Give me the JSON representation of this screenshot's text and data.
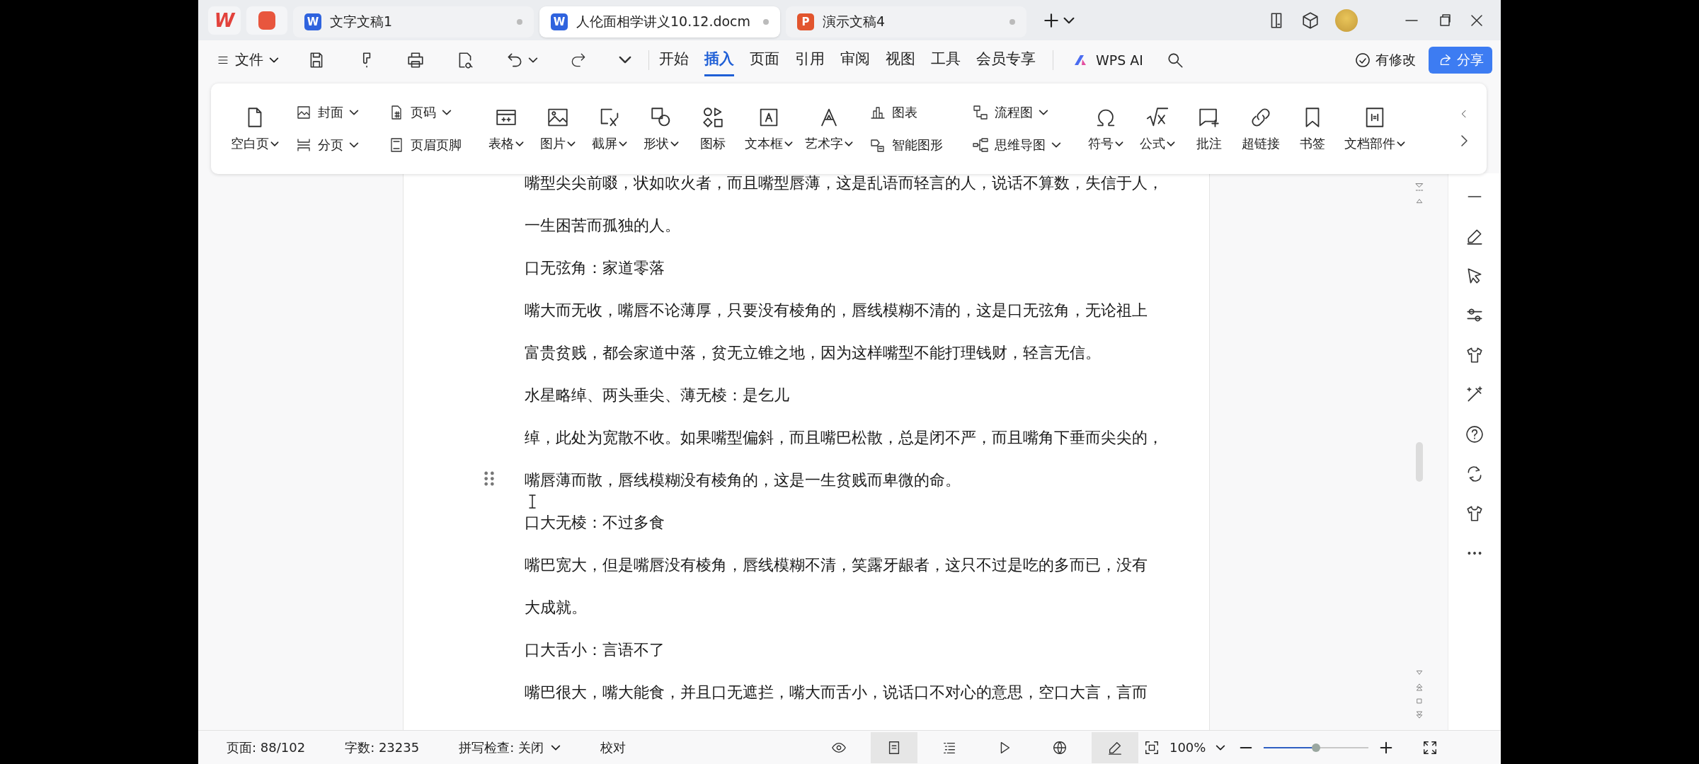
{
  "title_bar": {
    "logo_text": "W",
    "tabs": [
      {
        "badge": "W",
        "kind": "writer",
        "label": "文字文稿1",
        "selected": false
      },
      {
        "badge": "W",
        "kind": "writer",
        "label": "人伦面相学讲义10.12.docm",
        "selected": true
      },
      {
        "badge": "P",
        "kind": "presentation",
        "label": "演示文稿4",
        "selected": false
      }
    ]
  },
  "menu_bar": {
    "file_menu": "文件",
    "ribbon_tabs": [
      {
        "label": "开始",
        "selected": false
      },
      {
        "label": "插入",
        "selected": true
      },
      {
        "label": "页面",
        "selected": false
      },
      {
        "label": "引用",
        "selected": false
      },
      {
        "label": "审阅",
        "selected": false
      },
      {
        "label": "视图",
        "selected": false
      },
      {
        "label": "工具",
        "selected": false
      },
      {
        "label": "会员专享",
        "selected": false
      }
    ],
    "ai_button": "WPS AI",
    "changes_status": "有修改",
    "share_button": "分享"
  },
  "ribbon": {
    "groups": [
      {
        "kind": "large",
        "label": "空白页",
        "dropdown": true
      },
      {
        "kind": "stack",
        "items": [
          {
            "label": "封面",
            "dropdown": true
          },
          {
            "label": "分页",
            "dropdown": true
          }
        ]
      },
      {
        "kind": "stack",
        "items": [
          {
            "label": "页码",
            "dropdown": true
          },
          {
            "label": "页眉页脚",
            "dropdown": false
          }
        ]
      },
      {
        "kind": "large",
        "label": "表格",
        "dropdown": true
      },
      {
        "kind": "large",
        "label": "图片",
        "dropdown": true
      },
      {
        "kind": "large",
        "label": "截屏",
        "dropdown": true
      },
      {
        "kind": "large",
        "label": "形状",
        "dropdown": true
      },
      {
        "kind": "large",
        "label": "图标",
        "dropdown": false
      },
      {
        "kind": "large",
        "label": "文本框",
        "dropdown": true
      },
      {
        "kind": "large",
        "label": "艺术字",
        "dropdown": true
      },
      {
        "kind": "stack",
        "items": [
          {
            "label": "图表",
            "dropdown": false
          },
          {
            "label": "智能图形",
            "dropdown": false
          }
        ]
      },
      {
        "kind": "stack",
        "items": [
          {
            "label": "流程图",
            "dropdown": true
          },
          {
            "label": "思维导图",
            "dropdown": true
          }
        ]
      },
      {
        "kind": "large",
        "label": "符号",
        "dropdown": true
      },
      {
        "kind": "large",
        "label": "公式",
        "dropdown": true
      },
      {
        "kind": "large",
        "label": "批注",
        "dropdown": false
      },
      {
        "kind": "large",
        "label": "超链接",
        "dropdown": false
      },
      {
        "kind": "large",
        "label": "书签",
        "dropdown": false
      },
      {
        "kind": "large",
        "label": "文档部件",
        "dropdown": true
      }
    ]
  },
  "document": {
    "lines": [
      "嘴型尖尖前啜，状如吹火者，而且嘴型唇薄，这是乱语而轻言的人，说话不算数，失信于人，",
      "一生困苦而孤独的人。",
      "口无弦角：家道零落",
      "嘴大而无收，嘴唇不论薄厚，只要没有棱角的，唇线模糊不清的，这是口无弦角，无论祖上",
      "富贵贫贱，都会家道中落，贫无立锥之地，因为这样嘴型不能打理钱财，轻言无信。",
      "水星略绰、两头垂尖、薄无棱：是乞儿",
      "绰，此处为宽散不收。如果嘴型偏斜，而且嘴巴松散，总是闭不严，而且嘴角下垂而尖尖的，",
      "嘴唇薄而散，唇线模糊没有棱角的，这是一生贫贱而卑微的命。",
      "口大无棱：不过多食",
      "嘴巴宽大，但是嘴唇没有棱角，唇线模糊不清，笑露牙龈者，这只不过是吃的多而已，没有",
      "大成就。",
      "口大舌小：言语不了",
      "嘴巴很大，嘴大能食，并且口无遮拦，嘴大而舌小，说话口不对心的意思，空口大言，言而"
    ]
  },
  "status_bar": {
    "page": "页面: 88/102",
    "word_count": "字数: 23235",
    "spell_check": "拼写检查: 关闭",
    "proofread": "校对",
    "view_modes": [
      {
        "selected": false
      },
      {
        "selected": true
      },
      {
        "selected": false
      },
      {
        "selected": false
      },
      {
        "selected": false
      }
    ],
    "pen_mode": {
      "on": true
    },
    "zoom": {
      "value": "100%",
      "level": 0.5
    }
  }
}
